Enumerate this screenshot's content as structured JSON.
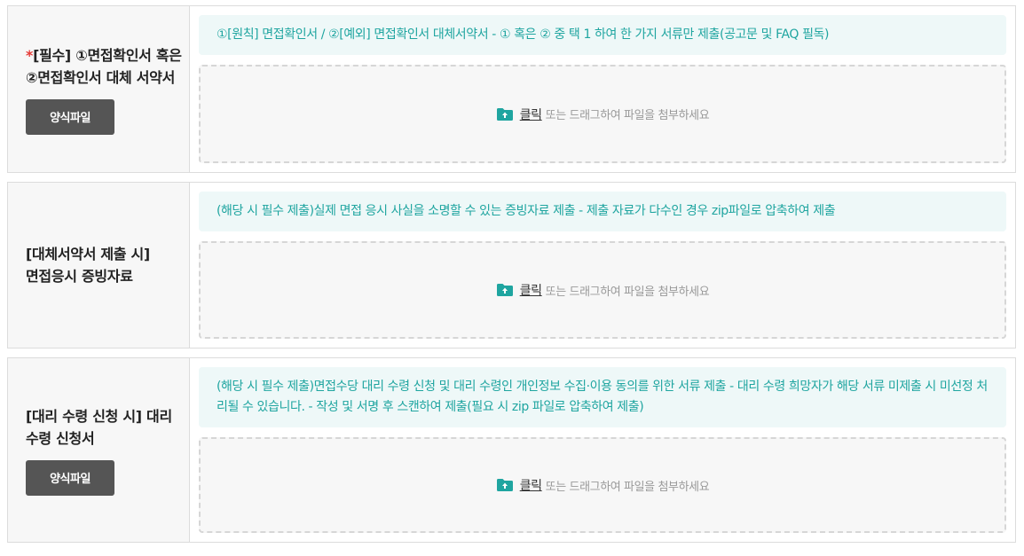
{
  "rows": [
    {
      "required_mark": "*",
      "title": "[필수] ①면접확인서 혹은 ②면접확인서 대체 서약서",
      "form_button": "양식파일",
      "notice": "①[원칙] 면접확인서 / ②[예외] 면접확인서 대체서약서 - ① 혹은 ② 중 택 1 하여 한 가지 서류만 제출(공고문 및 FAQ 필독)",
      "upload_click": "클릭",
      "upload_hint": "또는 드래그하여 파일을 첨부하세요"
    },
    {
      "title": "[대체서약서 제출 시] 면접응시 증빙자료",
      "notice": "(해당 시 필수 제출)실제 면접 응시 사실을 소명할 수 있는 증빙자료 제출 - 제출 자료가 다수인 경우 zip파일로 압축하여 제출",
      "upload_click": "클릭",
      "upload_hint": "또는 드래그하여 파일을 첨부하세요"
    },
    {
      "title": "[대리 수령 신청 시] 대리 수령 신청서",
      "form_button": "양식파일",
      "notice": "(해당 시 필수 제출)면접수당 대리 수령 신청 및 대리 수령인 개인정보 수집·이용 동의를 위한 서류 제출 - 대리 수령 희망자가 해당 서류 미제출 시 미선정 처리될 수 있습니다. - 작성 및 서명 후 스캔하여 제출(필요 시 zip 파일로 압축하여 제출)",
      "upload_click": "클릭",
      "upload_hint": "또는 드래그하여 파일을 첨부하세요"
    }
  ],
  "icons": {
    "upload": "folder-upload-icon"
  },
  "colors": {
    "accent": "#1fa5a0",
    "required": "#e53935",
    "button": "#555555"
  }
}
